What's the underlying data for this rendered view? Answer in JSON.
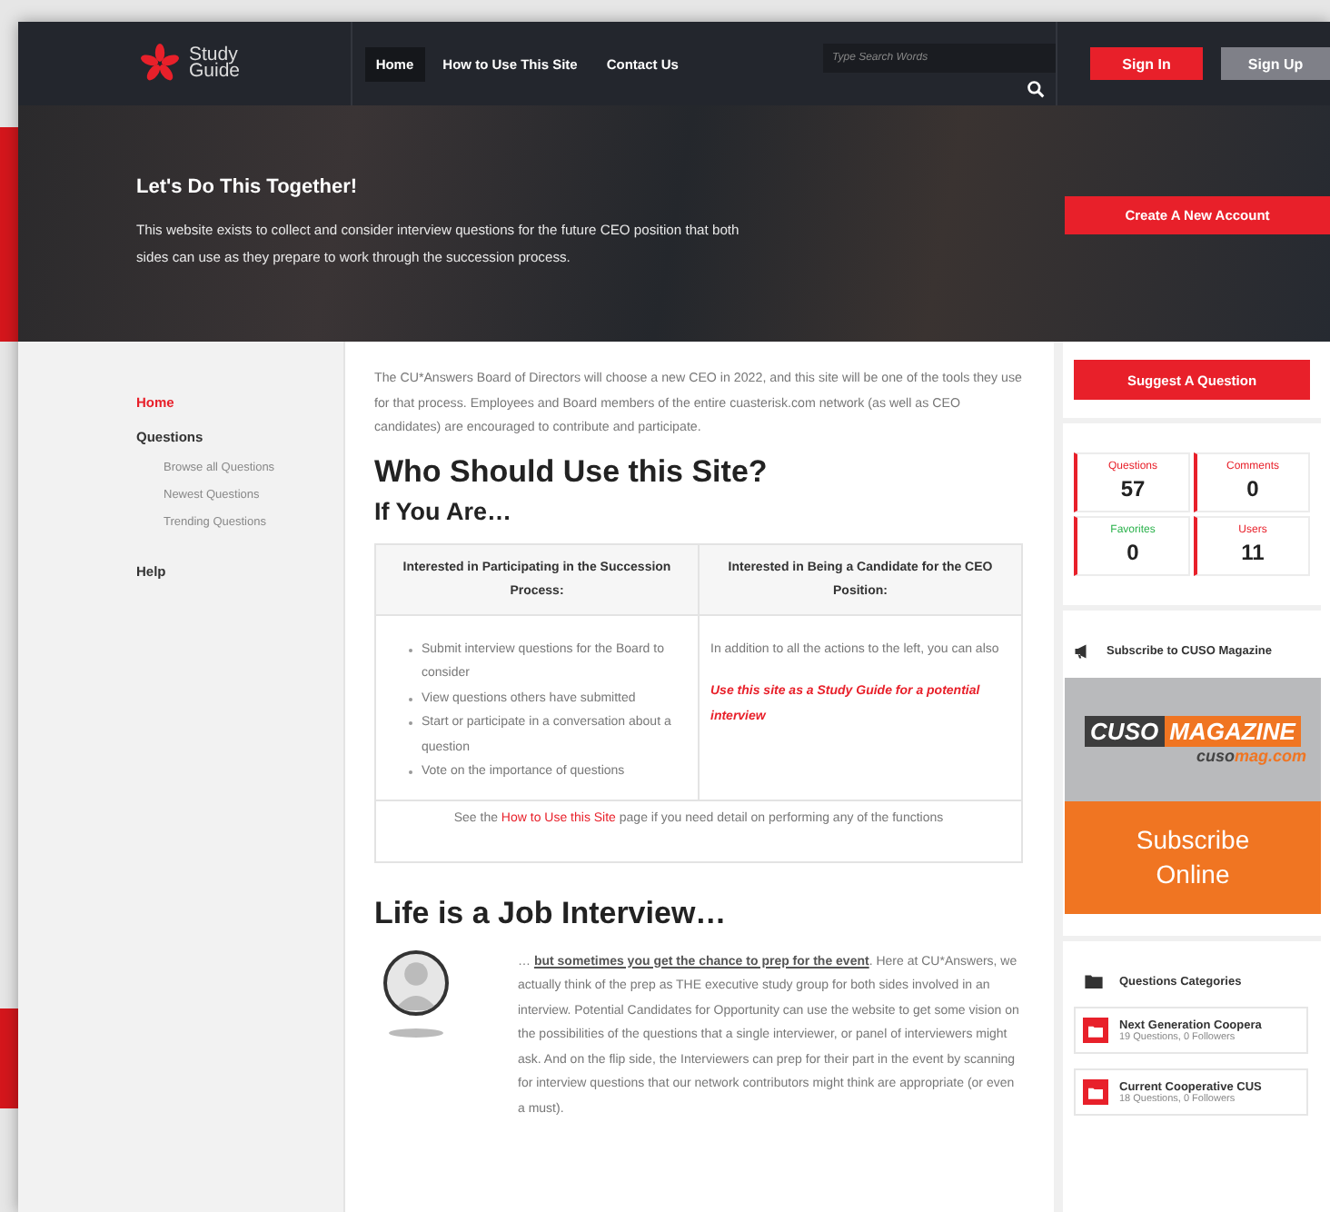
{
  "header": {
    "logo": {
      "line1": "Study",
      "line2": "Guide"
    },
    "nav": [
      {
        "label": "Home",
        "selected": true
      },
      {
        "label": "How to Use This Site",
        "selected": false
      },
      {
        "label": "Contact Us",
        "selected": false
      }
    ],
    "search": {
      "placeholder": "Type Search Words"
    },
    "buttons": [
      {
        "label": "Sign In",
        "kind": "primary"
      },
      {
        "label": "Sign Up",
        "kind": "secondary"
      }
    ]
  },
  "hero": {
    "title": "Let's Do This Together!",
    "text": "This website exists to collect and consider interview questions for the future CEO position that both sides can use as they prepare to work through the succession process.",
    "button": "Create A New Account"
  },
  "sidebar": {
    "items": [
      {
        "label": "Home",
        "selected": true
      },
      {
        "label": "Questions",
        "selected": false,
        "children": [
          {
            "label": "Browse all Questions",
            "selected": false
          },
          {
            "label": "Newest Questions",
            "selected": false
          },
          {
            "label": "Trending Questions",
            "selected": false
          }
        ]
      },
      {
        "label": "Help",
        "selected": false
      }
    ]
  },
  "main": {
    "intro": "The CU*Answers Board of Directors will choose a new CEO in 2022, and this site will be one of the tools they use for that process. Employees and Board members of the entire cuasterisk.com network (as well as CEO candidates) are encouraged to contribute and participate.",
    "heading": "Who Should Use this Site?",
    "subheading": "If You Are…",
    "table": {
      "columns": [
        "Interested in Participating in the Succession Process:",
        "Interested in Being a Candidate for the CEO Position:"
      ],
      "list": [
        "Submit interview questions for the Board to consider",
        "View questions others have submitted",
        "Start or participate in a conversation about a question",
        "Vote on the importance of questions"
      ],
      "candidate_text": "In addition to all the actions to the left, you can also",
      "candidate_highlight": "Use this site as a Study Guide for a potential interview",
      "footer": {
        "before": "See the ",
        "link": "How to Use this Site",
        "after": " page if you need detail on performing any of the functions"
      }
    },
    "life": {
      "heading": "Life is a Job Interview…",
      "prefix": "… ",
      "link": "but sometimes you get the chance to prep for the event",
      "text": ".  Here at CU*Answers, we actually think of the prep as THE executive study group for both sides involved in an interview.  Potential Candidates for Opportunity can use the website to get some vision on the possibilities of the questions that a single interviewer, or panel of interviewers might ask.  And on the flip side, the Interviewers can prep for their part in the event by scanning for interview questions that our network contributors might think are appropriate (or even a must)."
    }
  },
  "right": {
    "suggest_button": "Suggest A Question",
    "stats": [
      {
        "label": "Questions",
        "value": "57",
        "color": "#e8202a"
      },
      {
        "label": "Comments",
        "value": "0",
        "color": "#e8202a"
      },
      {
        "label": "Favorites",
        "value": "0",
        "color": "#2bb24c"
      },
      {
        "label": "Users",
        "value": "11",
        "color": "#e8202a"
      }
    ],
    "subscribe": {
      "title": "Subscribe to CUSO Magazine",
      "banner": {
        "brand_left": "CUSO",
        "brand_right": "MAGAZINE",
        "site_left": "cuso",
        "site_right": "mag.com",
        "cta": "Subscribe Online"
      }
    },
    "categories": {
      "title": "Questions Categories",
      "items": [
        {
          "name": "Next Generation Coopera",
          "meta": "19 Questions, 0 Followers"
        },
        {
          "name": "Current Cooperative CUS",
          "meta": "18 Questions, 0 Followers"
        }
      ]
    }
  }
}
